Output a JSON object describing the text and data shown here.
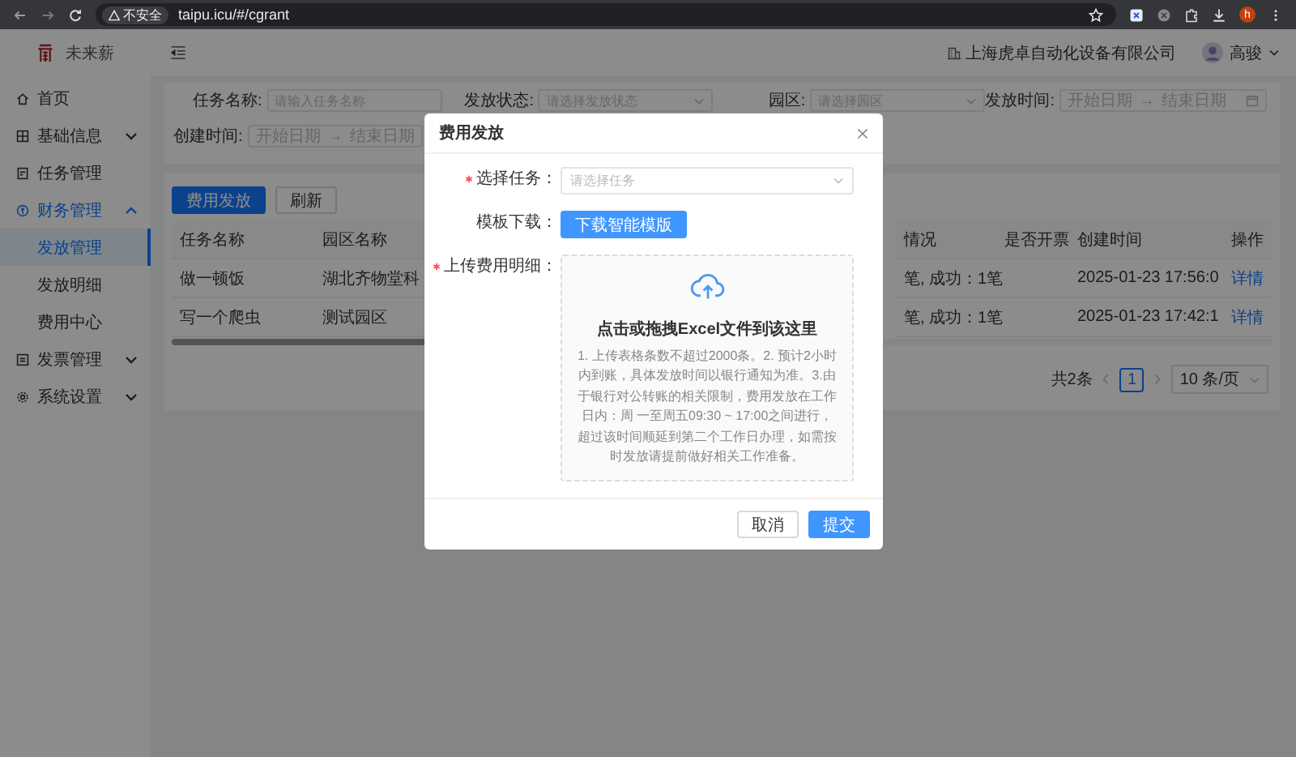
{
  "browser": {
    "security_label": "不安全",
    "url": "taipu.icu/#/cgrant",
    "profile_initial": "h"
  },
  "header": {
    "logo_text": "未来薪",
    "company": "上海虎卓自动化设备有限公司",
    "user": "高骏"
  },
  "sidebar": {
    "items": [
      {
        "label": "首页",
        "selected": false
      },
      {
        "label": "基础信息",
        "expanded": false,
        "selected": false
      },
      {
        "label": "任务管理",
        "selected": false
      },
      {
        "label": "财务管理",
        "expanded": true,
        "selected": true,
        "children": [
          {
            "label": "发放管理",
            "selected": true
          },
          {
            "label": "发放明细",
            "selected": false
          },
          {
            "label": "费用中心",
            "selected": false
          }
        ]
      },
      {
        "label": "发票管理",
        "expanded": false,
        "selected": false
      },
      {
        "label": "系统设置",
        "expanded": false,
        "selected": false
      }
    ]
  },
  "filters": [
    {
      "label": "任务名称:",
      "kind": "input",
      "placeholder": "请输入任务名称"
    },
    {
      "label": "发放状态:",
      "kind": "select",
      "placeholder": "请选择发放状态"
    },
    {
      "label": "园区:",
      "kind": "select",
      "placeholder": "请选择园区"
    },
    {
      "label": "发放时间:",
      "kind": "daterange",
      "start": "开始日期",
      "separator": "→",
      "end": "结束日期"
    },
    {
      "label": "创建时间:",
      "kind": "daterange",
      "start": "开始日期",
      "separator": "→",
      "end": "结束日期"
    }
  ],
  "actions": [
    {
      "label": "费用发放",
      "kind": "primary"
    },
    {
      "label": "刷新",
      "kind": "default"
    }
  ],
  "table": {
    "columns": [
      "任务名称",
      "园区名称",
      "情况",
      "是否开票",
      "创建时间",
      "操作"
    ],
    "rows": [
      {
        "cells": [
          "做一顿饭",
          "湖北齐物堂科",
          "笔, 成功：1笔",
          "",
          "2025-01-23 17:56:0",
          "详情"
        ]
      },
      {
        "cells": [
          "写一个爬虫",
          "测试园区",
          "笔, 成功：1笔",
          "",
          "2025-01-23 17:42:1",
          "详情"
        ]
      }
    ]
  },
  "pagination": {
    "total": "共2条",
    "pages": [
      {
        "label": "1",
        "selected": true
      }
    ],
    "page_size": "10 条/页"
  },
  "modal": {
    "title": "费用发放",
    "fields": [
      {
        "label": "选择任务：",
        "required": true,
        "kind": "select",
        "placeholder": "请选择任务"
      },
      {
        "label": "模板下载：",
        "required": false,
        "kind": "button",
        "button": "下载智能模版"
      },
      {
        "label": "上传费用明细：",
        "required": true,
        "kind": "upload",
        "title": "点击或拖拽Excel文件到该这里",
        "hint": "1. 上传表格条数不超过2000条。2. 预计2小时内到账，具体发放时间以银行通知为准。3.由于银行对公转账的相关限制，费用发放在工作日内：周 一至周五09:30 ~ 17:00之间进行，超过该时间顺延到第二个工作日办理，如需按时发放请提前做好相关工作准备。"
      }
    ],
    "buttons": [
      {
        "label": "取消",
        "kind": "default"
      },
      {
        "label": "提交",
        "kind": "primary"
      }
    ]
  }
}
